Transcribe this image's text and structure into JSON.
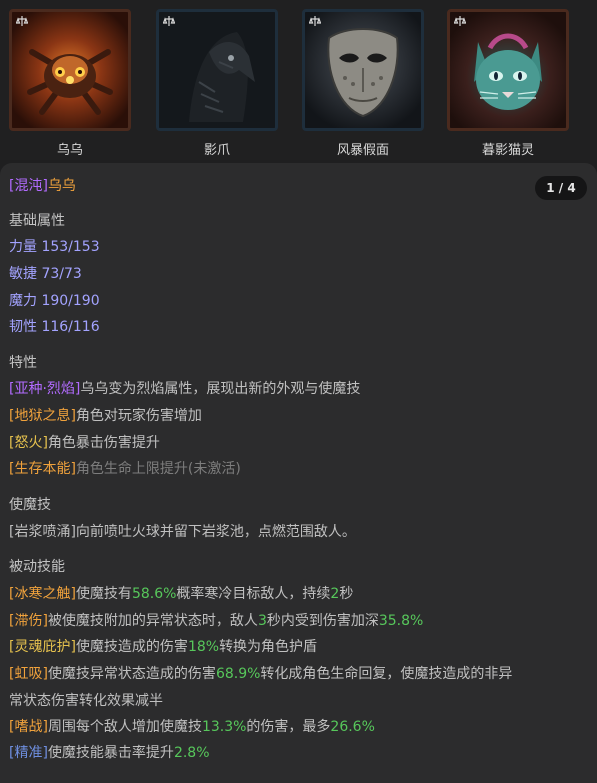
{
  "pets": [
    {
      "name": "乌乌",
      "icon": "scale-icon"
    },
    {
      "name": "影爪",
      "icon": "scale-icon"
    },
    {
      "name": "风暴假面",
      "icon": "scale-icon"
    },
    {
      "name": "暮影猫灵",
      "icon": "scale-icon"
    }
  ],
  "detail": {
    "title_tag": "[混沌]",
    "title_name": "乌乌",
    "counter": "1 / 4",
    "base_header": "基础属性",
    "stats": [
      "力量 153/153",
      "敏捷 73/73",
      "魔力 190/190",
      "韧性 116/116"
    ],
    "traits_header": "特性",
    "traits": [
      {
        "tag": "[亚种·烈焰]",
        "text": "乌乌变为烈焰属性，展现出新的外观与使魔技"
      },
      {
        "tag": "[地狱之息]",
        "text": "角色对玩家伤害增加"
      },
      {
        "tag": "[怒火]",
        "text": "角色暴击伤害提升"
      },
      {
        "tag": "[生存本能]",
        "text": "角色生命上限提升(未激活)"
      }
    ],
    "skill_header": "使魔技",
    "skill_text": "[岩浆喷涌]向前喷吐火球并留下岩浆池，点燃范围敌人。",
    "passive_header": "被动技能",
    "passives": {
      "p1": {
        "tag": "[冰寒之触]",
        "a": "使魔技有",
        "v1": "58.6%",
        "b": "概率寒冷目标敌人，持续",
        "v2": "2",
        "c": "秒"
      },
      "p2": {
        "tag": "[滞伤]",
        "a": "被使魔技附加的异常状态时，敌人",
        "v1": "3",
        "b": "秒内受到伤害加深",
        "v2": "35.8%"
      },
      "p3": {
        "tag": "[灵魂庇护]",
        "a": "使魔技造成的伤害",
        "v1": "18%",
        "b": "转换为角色护盾"
      },
      "p4": {
        "tag": "[虹吸]",
        "a": "使魔技异常状态造成的伤害",
        "v1": "68.9%",
        "b": "转化成角色生命回复，使魔技造成的非异",
        "c": "常状态伤害转化效果减半"
      },
      "p5": {
        "tag": "[嗜战]",
        "a": "周围每个敌人增加使魔技",
        "v1": "13.3%",
        "b": "的伤害，最多",
        "v2": "26.6%"
      },
      "p6": {
        "tag": "[精准]",
        "a": "使魔技能暴击率提升",
        "v1": "2.8%"
      }
    }
  },
  "colors": {
    "background": "#1f1f20",
    "panel": "#2c2c2d",
    "stat": "#a3a3ff",
    "legendary_tag": "#b26bff",
    "orange_tag": "#f0a23c",
    "gold_tag": "#e6c24e",
    "value_green": "#57c75b",
    "inactive": "#7d7d7d"
  }
}
